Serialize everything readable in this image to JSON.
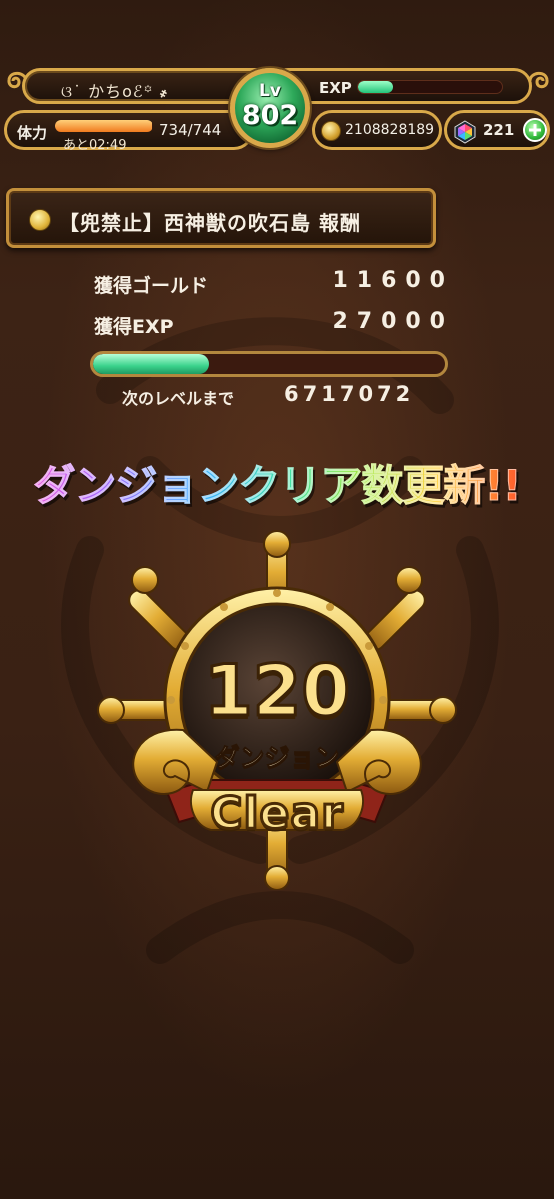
{
  "header": {
    "player_name": "ଓ˙ かちoℰ꙳ ҂",
    "exp_label": "EXP",
    "exp_progress": 0.24,
    "level_label": "Lv",
    "level_value": "802",
    "stamina_label": "体力",
    "stamina_current_fraction": 0.99,
    "stamina_timer": "あと02:49",
    "stamina_value": "734/744",
    "gold_value": "2108828189",
    "gem_value": "221"
  },
  "reward": {
    "dungeon_title": "【兜禁止】西神獣の吹石島 報酬",
    "gold_label": "獲得ゴールド",
    "gold_value": "11600",
    "exp_label": "獲得EXP",
    "exp_value": "27000",
    "level_progress": 0.33,
    "next_level_label": "次のレベルまで",
    "next_level_value": "6717072"
  },
  "record": {
    "headline": "ダンジョンクリア数更新!!",
    "count": "120",
    "unit": "ダンジョン",
    "clear_label": "Clear"
  },
  "colors": {
    "gold_trim": "#d9a94a",
    "level_badge_green": "#2ea95a",
    "exp_bar": "#24c47a",
    "stamina_bar": "#f07a1e",
    "background": "#3a2114"
  }
}
